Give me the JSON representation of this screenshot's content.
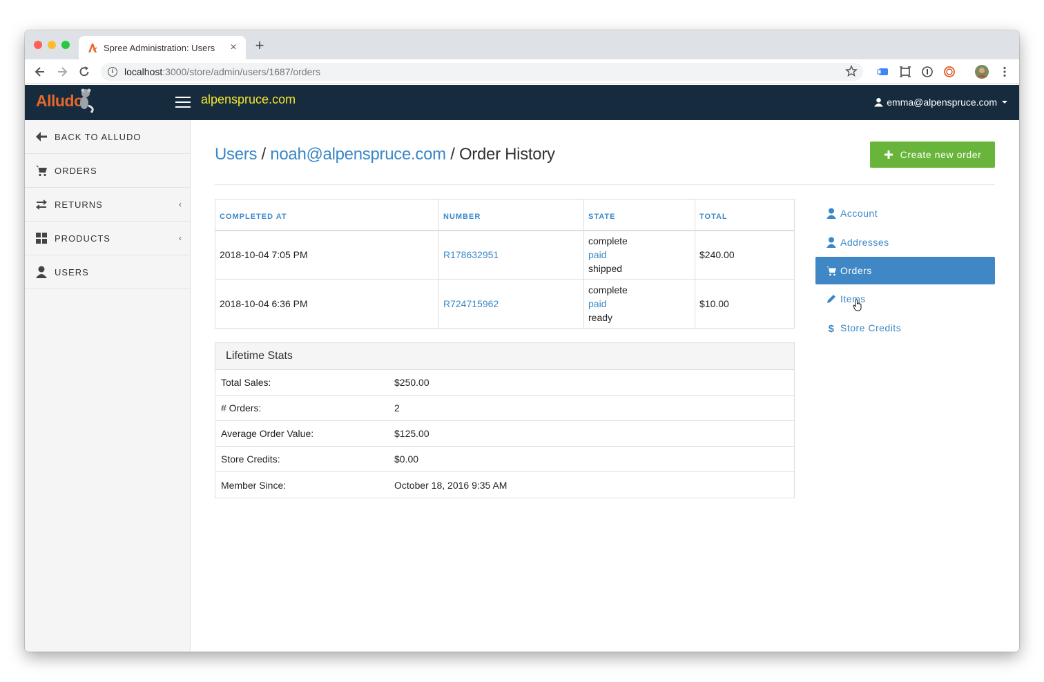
{
  "browser": {
    "tab_title": "Spree Administration: Users",
    "tab_close": "×",
    "new_tab": "+",
    "url_host": "localhost",
    "url_path": ":3000/store/admin/users/1687/orders"
  },
  "header": {
    "logo": "Alludo",
    "store_name": "alpenspruce.com",
    "user_email": "emma@alpenspruce.com"
  },
  "sidebar": {
    "items": [
      {
        "label": "BACK TO ALLUDO",
        "icon": "arrow-left-icon"
      },
      {
        "label": "ORDERS",
        "icon": "cart-icon"
      },
      {
        "label": "RETURNS",
        "icon": "exchange-icon",
        "caret": "‹"
      },
      {
        "label": "PRODUCTS",
        "icon": "grid-icon",
        "caret": "‹"
      },
      {
        "label": "USERS",
        "icon": "user-icon"
      }
    ]
  },
  "page": {
    "crumb_users": "Users",
    "sep1": " / ",
    "crumb_user": "noah@alpenspruce.com",
    "sep2": " / ",
    "title": "Order History",
    "create_button": "Create new order"
  },
  "orders": {
    "headers": [
      "COMPLETED AT",
      "NUMBER",
      "STATE",
      "TOTAL"
    ],
    "rows": [
      {
        "completed_at": "2018-10-04 7:05 PM",
        "number": "R178632951",
        "state": "complete",
        "payment": "paid",
        "shipment": "shipped",
        "total": "$240.00"
      },
      {
        "completed_at": "2018-10-04 6:36 PM",
        "number": "R724715962",
        "state": "complete",
        "payment": "paid",
        "shipment": "ready",
        "total": "$10.00"
      }
    ]
  },
  "stats": {
    "title": "Lifetime Stats",
    "rows": [
      {
        "label": "Total Sales:",
        "value": "$250.00"
      },
      {
        "label": "# Orders:",
        "value": "2"
      },
      {
        "label": "Average Order Value:",
        "value": "$125.00"
      },
      {
        "label": "Store Credits:",
        "value": "$0.00"
      },
      {
        "label": "Member Since:",
        "value": "October 18, 2016 9:35 AM"
      }
    ]
  },
  "user_nav": {
    "items": [
      {
        "label": "Account",
        "icon": "user-icon"
      },
      {
        "label": "Addresses",
        "icon": "user-icon"
      },
      {
        "label": "Orders",
        "icon": "cart-icon",
        "active": true
      },
      {
        "label": "Items",
        "icon": "pencil-icon"
      },
      {
        "label": "Store Credits",
        "icon": "dollar-icon"
      }
    ]
  },
  "colors": {
    "header_bg": "#172b3f",
    "link": "#3a87c8",
    "store_name": "#f4e62a",
    "create_button": "#69b53b",
    "active_nav": "#3f88c5"
  }
}
